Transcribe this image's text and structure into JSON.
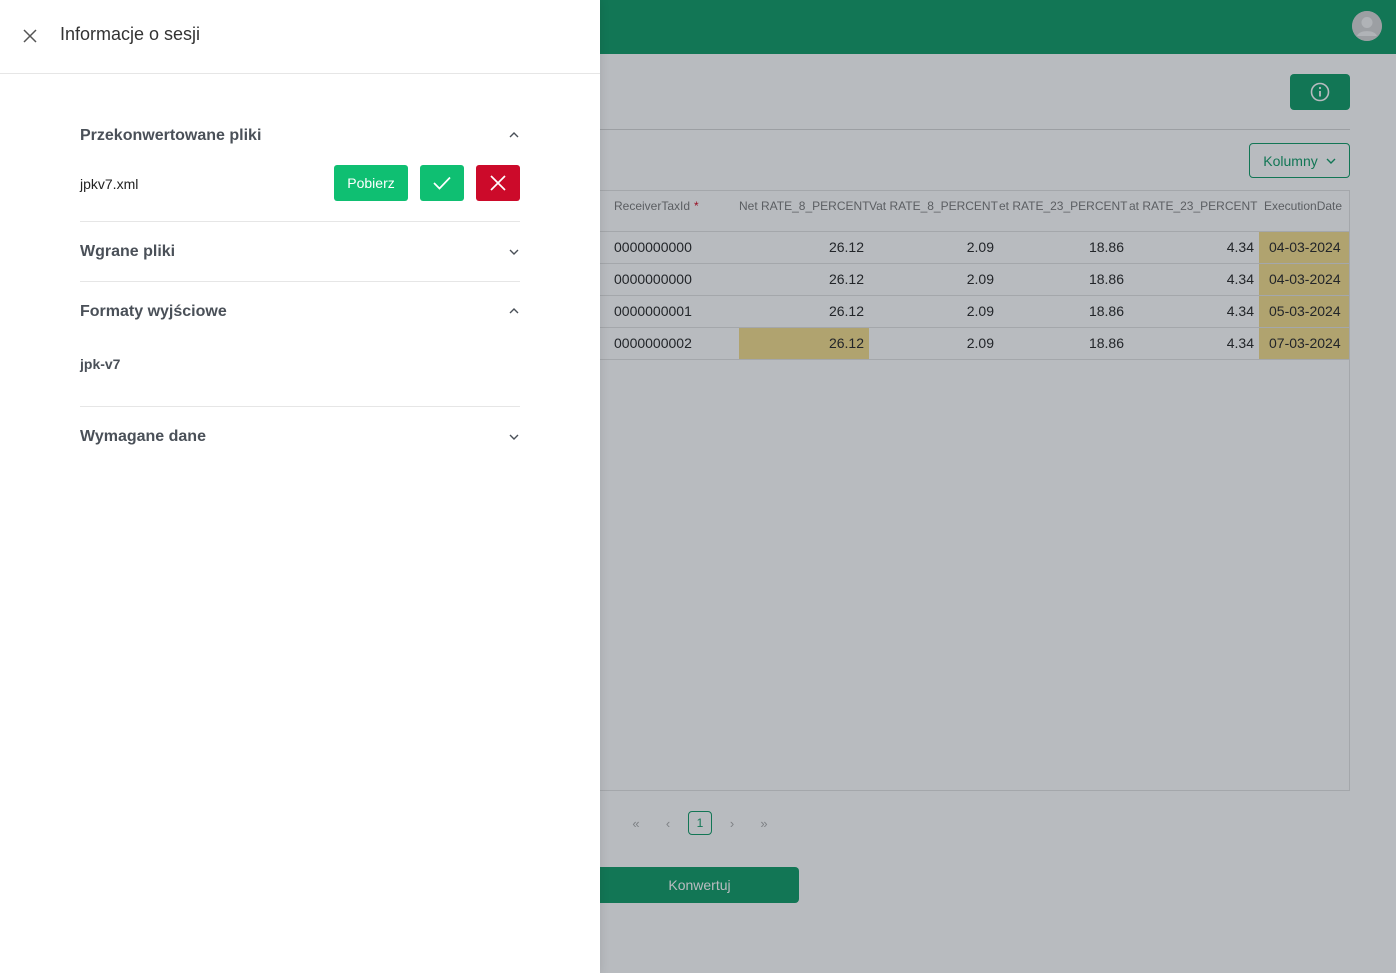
{
  "colors": {
    "brand": "#0b9a63",
    "success": "#0fbf72",
    "danger": "#cc0a2a",
    "highlight": "#f4dc8a"
  },
  "drawer": {
    "title": "Informacje o sesji",
    "close_icon": "close-icon",
    "sections": {
      "converted": {
        "title": "Przekonwertowane pliki",
        "expanded": true,
        "files": [
          {
            "name": "jpkv7.xml",
            "download_label": "Pobierz"
          }
        ]
      },
      "uploaded": {
        "title": "Wgrane pliki",
        "expanded": false
      },
      "output_formats": {
        "title": "Formaty wyjściowe",
        "expanded": true,
        "items": [
          "jpk-v7"
        ]
      },
      "required": {
        "title": "Wymagane dane",
        "expanded": false
      }
    }
  },
  "background": {
    "columns_button": "Kolumny",
    "table": {
      "headers": [
        "ReceiverTaxId",
        "Net RATE_8_PERCENT",
        "Vat RATE_8_PERCENT",
        "et RATE_23_PERCENT",
        "at RATE_23_PERCENT",
        "ExecutionDate"
      ],
      "rows": [
        [
          "0000000000",
          "26.12",
          "2.09",
          "18.86",
          "4.34",
          "04-03-2024"
        ],
        [
          "0000000000",
          "26.12",
          "2.09",
          "18.86",
          "4.34",
          "04-03-2024"
        ],
        [
          "0000000001",
          "26.12",
          "2.09",
          "18.86",
          "4.34",
          "05-03-2024"
        ],
        [
          "0000000002",
          "26.12",
          "2.09",
          "18.86",
          "4.34",
          "07-03-2024"
        ]
      ]
    },
    "pagination": {
      "current": "1",
      "first": "«",
      "prev": "‹",
      "next": "›",
      "last": "»"
    },
    "convert_button": "Konwertuj"
  }
}
